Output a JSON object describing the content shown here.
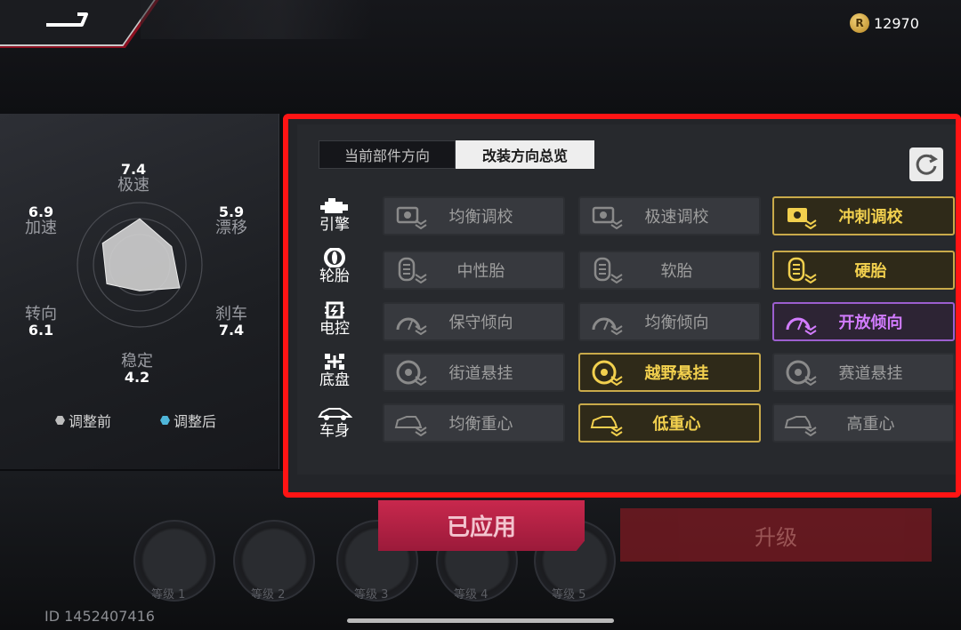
{
  "header": {
    "coins": "12970",
    "coin_icon": "coin-icon"
  },
  "stats": {
    "top_speed": {
      "label": "极速",
      "value": "7.4"
    },
    "drift": {
      "label": "漂移",
      "value": "5.9"
    },
    "brake": {
      "label": "刹车",
      "value": "7.4"
    },
    "stability": {
      "label": "稳定",
      "value": "4.2"
    },
    "steering": {
      "label": "转向",
      "value": "6.1"
    },
    "acceleration": {
      "label": "加速",
      "value": "6.9"
    },
    "legend_before": "调整前",
    "legend_after": "调整后",
    "legend_before_color": "#bdbdbd",
    "legend_after_color": "#4fb6d9"
  },
  "tabs": {
    "current_direction": "当前部件方向",
    "overview": "改装方向总览"
  },
  "rows": [
    {
      "label": "引擎",
      "icon": "engine-icon",
      "options": [
        "均衡调校",
        "极速调校",
        "冲刺调校"
      ]
    },
    {
      "label": "轮胎",
      "icon": "tire-icon",
      "options": [
        "中性胎",
        "软胎",
        "硬胎"
      ]
    },
    {
      "label": "电控",
      "icon": "chip-icon",
      "options": [
        "保守倾向",
        "均衡倾向",
        "开放倾向"
      ]
    },
    {
      "label": "底盘",
      "icon": "chassis-icon",
      "options": [
        "街道悬挂",
        "越野悬挂",
        "赛道悬挂"
      ]
    },
    {
      "label": "车身",
      "icon": "car-body-icon",
      "options": [
        "均衡重心",
        "低重心",
        "高重心"
      ]
    }
  ],
  "colors": {
    "gold": "#f2d04e",
    "purple": "#d27cff",
    "highlight_border": "#ff1414"
  },
  "bottom": {
    "applied_label": "已应用",
    "upgrade_label": "升级",
    "gauge_labels": [
      "等级 1",
      "等级 2",
      "等级 3",
      "等级 4",
      "等级 5"
    ],
    "user_id": "ID 1452407416"
  }
}
